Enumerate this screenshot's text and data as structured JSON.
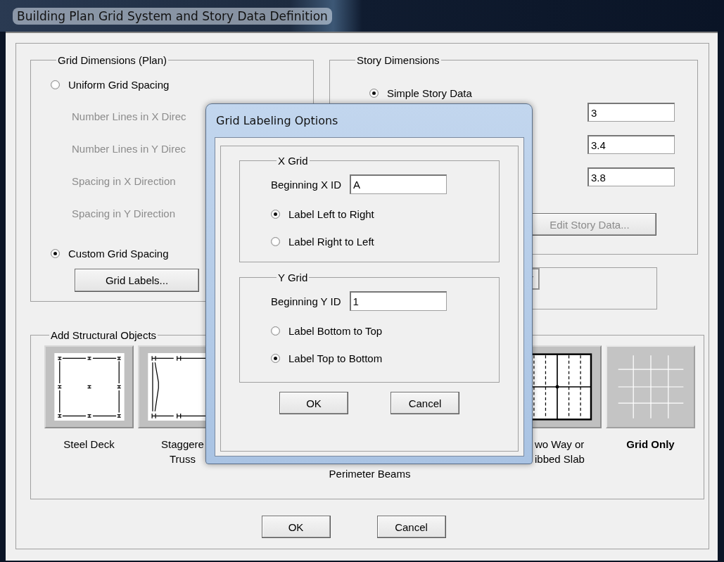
{
  "window": {
    "title": "Building Plan Grid System and Story Data Definition"
  },
  "grid_dimensions": {
    "title": "Grid Dimensions (Plan)",
    "uniform": {
      "label": "Uniform Grid Spacing",
      "selected": false
    },
    "fields": [
      {
        "label": "Number Lines in X Direc",
        "disabled": true
      },
      {
        "label": "Number Lines in Y Direc",
        "disabled": true
      },
      {
        "label": "Spacing in X Direction",
        "disabled": true
      },
      {
        "label": "Spacing in Y Direction",
        "disabled": true
      }
    ],
    "custom": {
      "label": "Custom Grid Spacing",
      "selected": true
    },
    "button": "Grid Labels..."
  },
  "story_dimensions": {
    "title": "Story Dimensions",
    "simple": {
      "label": "Simple Story Data",
      "selected": true
    },
    "fields": [
      {
        "value": "3"
      },
      {
        "value": "3.4"
      },
      {
        "value": "3.8"
      }
    ],
    "edit_button": {
      "label": "Edit Story Data...",
      "disabled": true
    }
  },
  "structural_objects": {
    "title": "Add Structural Objects",
    "items": [
      {
        "kind": "steel-deck",
        "label_lines": [
          "Steel Deck"
        ],
        "selected": false
      },
      {
        "kind": "staggered-truss",
        "label_lines": [
          "Staggere",
          "Truss"
        ],
        "selected": false
      },
      {
        "kind": "covered",
        "label_lines": [
          "Perimeter Beams"
        ]
      },
      {
        "kind": "two-way-slab",
        "label_lines": [
          "wo Way or",
          "ibbed Slab"
        ],
        "selected": false
      },
      {
        "kind": "grid-only",
        "label_lines": [
          "Grid Only"
        ],
        "selected": true
      }
    ]
  },
  "buttons": [
    {
      "label": "OK"
    },
    {
      "label": "Cancel"
    }
  ],
  "grid_labeling": {
    "title": "Grid Labeling Options",
    "groups": [
      {
        "title": "X Grid",
        "id_label": "Beginning X ID",
        "id_value": "A",
        "options": [
          {
            "label": "Label Left to Right",
            "selected": true
          },
          {
            "label": "Label Right to Left",
            "selected": false
          }
        ]
      },
      {
        "title": "Y Grid",
        "id_label": "Beginning Y ID",
        "id_value": "1",
        "options": [
          {
            "label": "Label Bottom to Top",
            "selected": false
          },
          {
            "label": "Label Top to Bottom",
            "selected": true
          }
        ]
      }
    ],
    "buttons": [
      {
        "label": "OK"
      },
      {
        "label": "Cancel"
      }
    ]
  }
}
